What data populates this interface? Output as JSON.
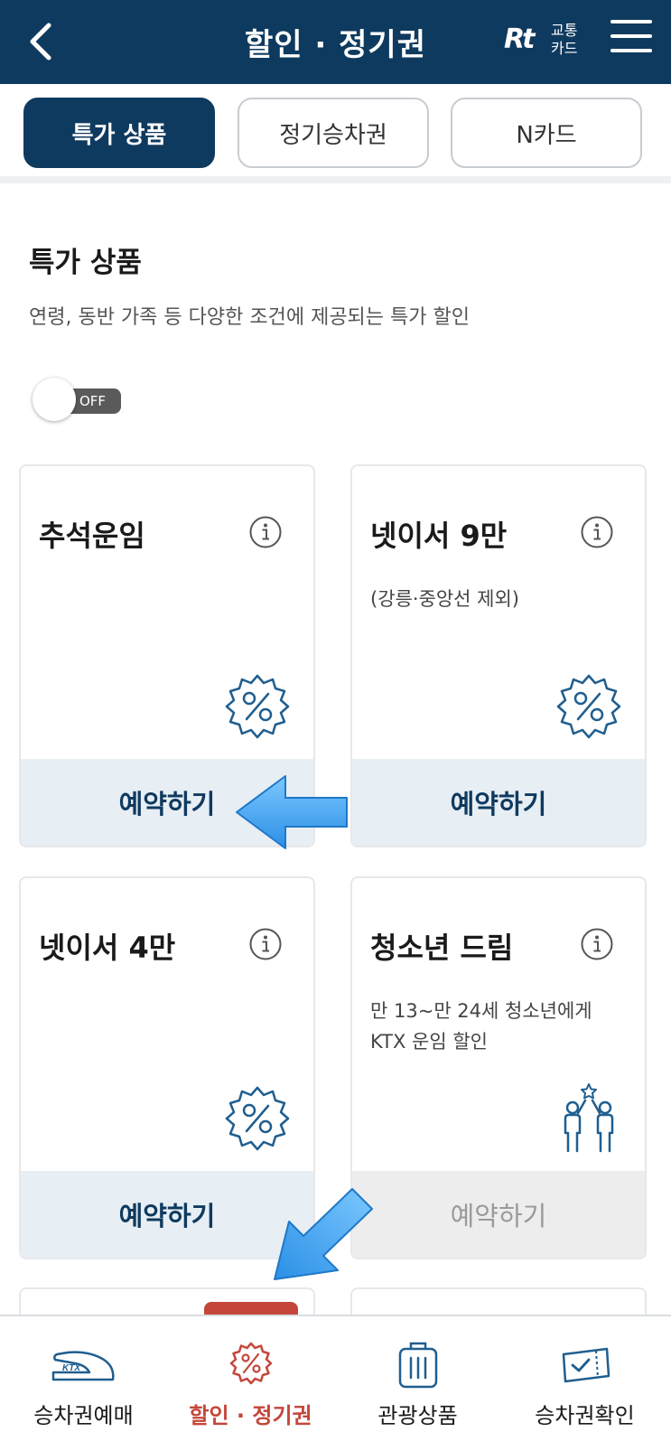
{
  "header": {
    "title": "할인 · 정기권",
    "transit_card_mark": "Rt",
    "transit_card_line1": "교통",
    "transit_card_line2": "카드"
  },
  "tabs": [
    {
      "label": "특가 상품",
      "active": true
    },
    {
      "label": "정기승차권",
      "active": false
    },
    {
      "label": "N카드",
      "active": false
    }
  ],
  "section": {
    "title": "특가 상품",
    "description": "연령, 동반 가족 등 다양한 조건에 제공되는 특가 할인"
  },
  "toggle": {
    "label": "OFF",
    "state": "off"
  },
  "cards": [
    {
      "title": "추석운임",
      "description": "",
      "icon": "discount-badge-icon",
      "button": "예약하기",
      "enabled": true
    },
    {
      "title": "넷이서 9만",
      "description": "(강릉·중앙선 제외)",
      "icon": "discount-badge-icon",
      "button": "예약하기",
      "enabled": true
    },
    {
      "title": "넷이서 4만",
      "description": "",
      "icon": "discount-badge-icon",
      "button": "예약하기",
      "enabled": true
    },
    {
      "title": "청소년 드림",
      "description": "만 13~만 24세 청소년에게\nKTX 운임 할인",
      "icon": "youth-high-five-icon",
      "button": "예약하기",
      "enabled": false
    }
  ],
  "bottom_nav": [
    {
      "label": "승차권예매",
      "icon": "ktx-train-icon",
      "active": false
    },
    {
      "label": "할인 · 정기권",
      "icon": "discount-badge-icon",
      "active": true
    },
    {
      "label": "관광상품",
      "icon": "suitcase-icon",
      "active": false
    },
    {
      "label": "승차권확인",
      "icon": "ticket-check-icon",
      "active": false
    }
  ],
  "colors": {
    "navy": "#0f3a5f",
    "accent_red": "#c4463a",
    "button_bg": "#e7eef4",
    "annotation_arrow": "#3aa6f2"
  }
}
